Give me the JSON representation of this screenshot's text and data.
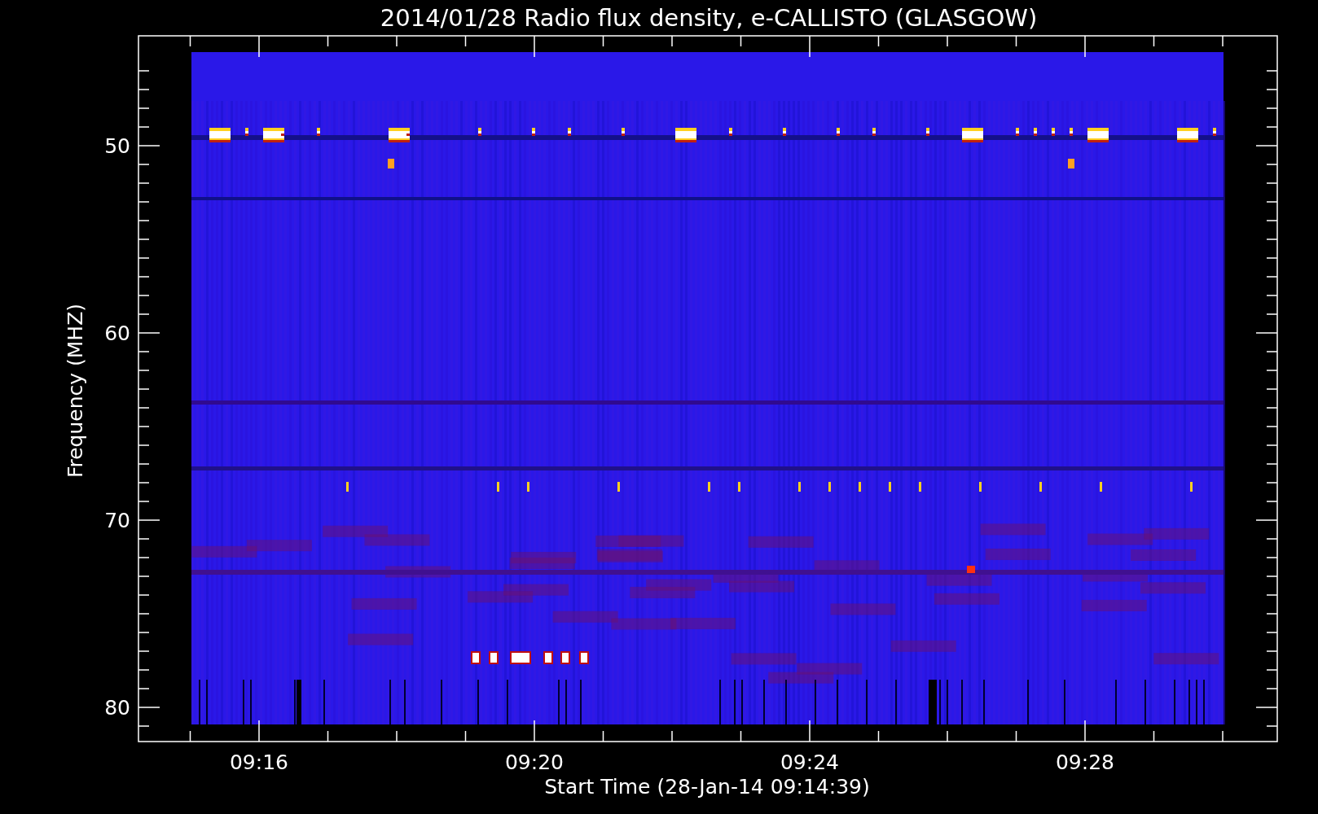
{
  "plot": {
    "title": "2014/01/28  Radio flux density, e-CALLISTO (GLASGOW)",
    "ylabel": "Frequency (MHZ)",
    "xlabel": "Start Time (28-Jan-14 09:14:39)",
    "yticks": [
      "50",
      "60",
      "70",
      "80"
    ],
    "xticks": [
      "09:16",
      "09:20",
      "09:24",
      "09:28"
    ]
  }
}
